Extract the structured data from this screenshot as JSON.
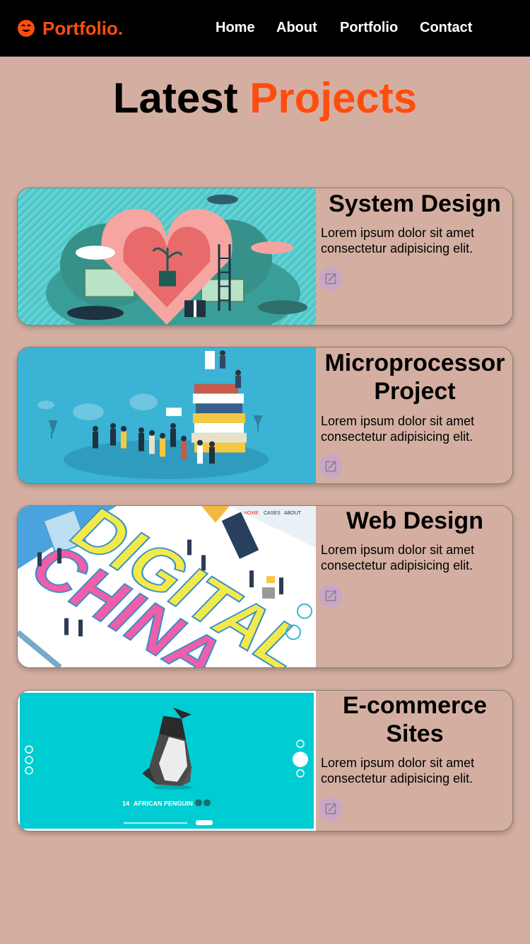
{
  "nav": {
    "logo_text": "Portfolio.",
    "logo_icon": "smile-face-icon",
    "links": [
      "Home",
      "About",
      "Portfolio",
      "Contact"
    ]
  },
  "section": {
    "title_part1": "Latest",
    "title_part2": "Projects"
  },
  "colors": {
    "accent": "#ff4d0d",
    "background": "#d4afa1",
    "navbar": "#000000",
    "button": "#c9a7c4"
  },
  "projects": [
    {
      "title": "System Design",
      "description": "Lorem ipsum dolor sit amet consectetur adipisicing elit.",
      "icon": "external-link-icon"
    },
    {
      "title": "Microprocessor Project",
      "description": "Lorem ipsum dolor sit amet consectetur adipisicing elit.",
      "icon": "external-link-icon"
    },
    {
      "title": "Web Design",
      "description": "Lorem ipsum dolor sit amet consectetur adipisicing elit.",
      "icon": "external-link-icon",
      "image_text": {
        "word1": "DIGITAL",
        "word2": "CHINA",
        "menu": [
          "HOME",
          "CASES",
          "ABOUT"
        ]
      }
    },
    {
      "title": "E-commerce Sites",
      "description": "Lorem ipsum dolor sit amet consectetur adipisicing elit.",
      "icon": "external-link-icon",
      "image_text": {
        "number": "14",
        "caption": "AFRICAN PENGUIN"
      }
    }
  ]
}
